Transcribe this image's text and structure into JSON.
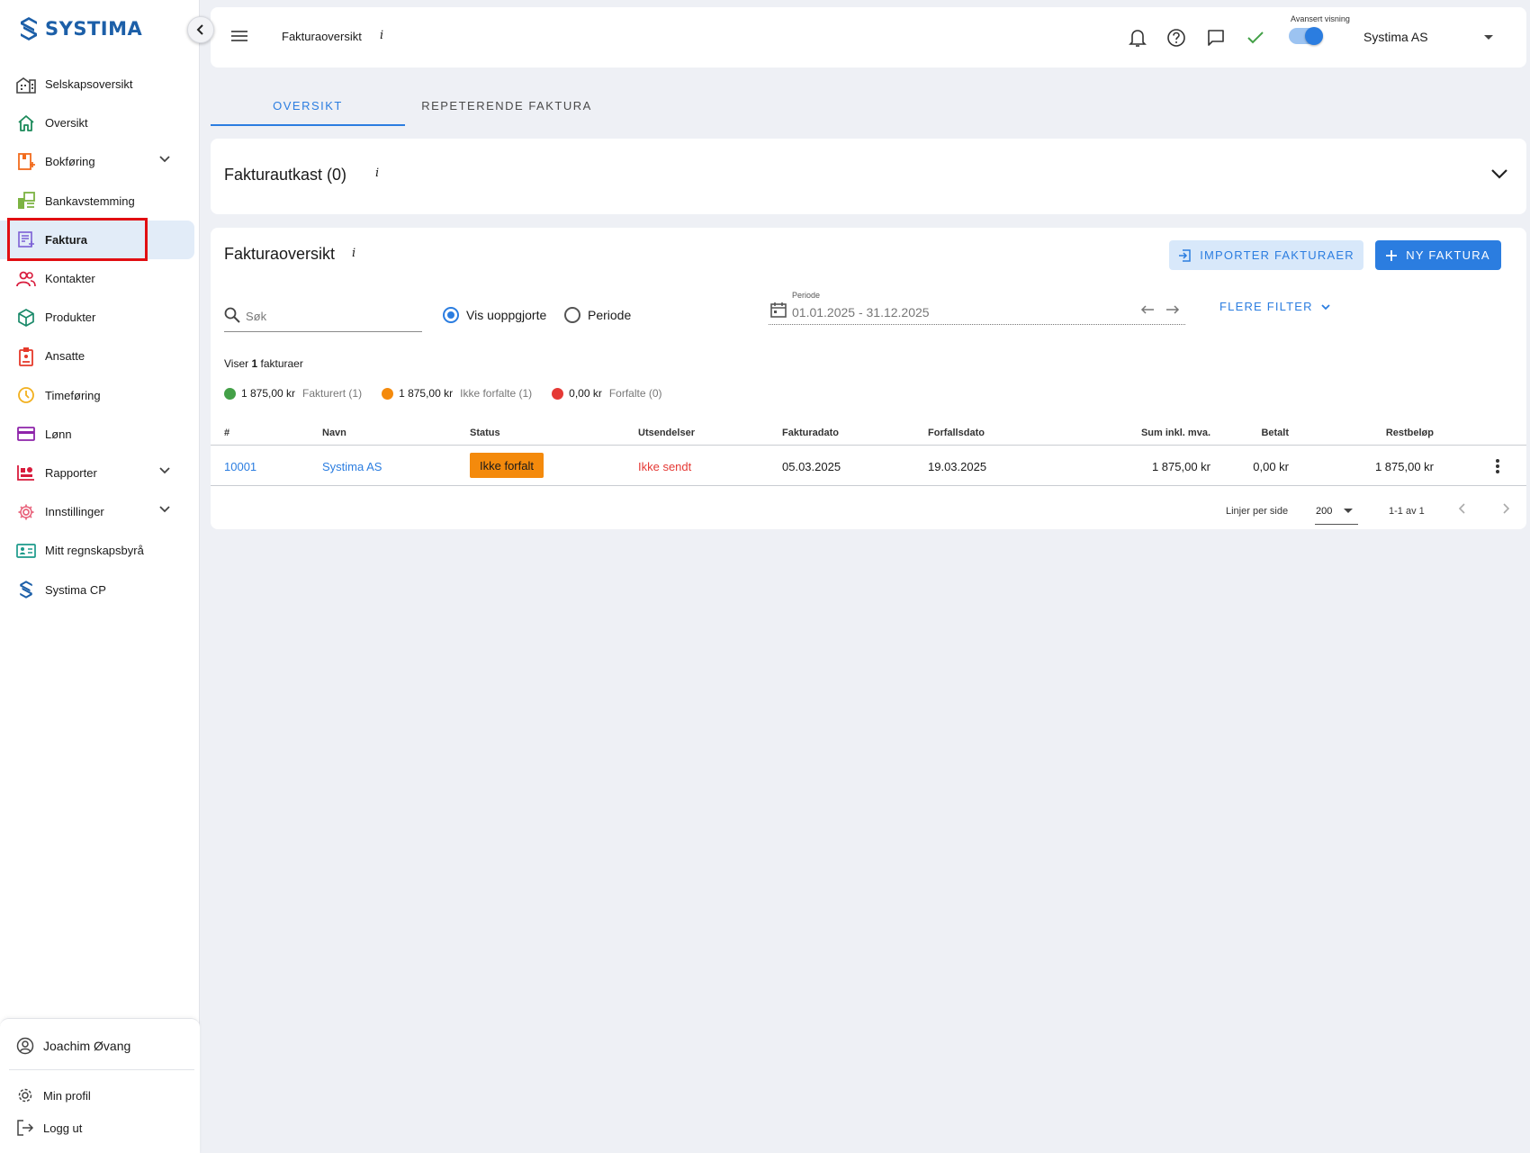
{
  "app": {
    "logo_text": "SYSTIMA",
    "brand_color": "#1c5fa8",
    "accent_color": "#2b7de0"
  },
  "sidebar": {
    "items": [
      {
        "label": "Selskapsoversikt",
        "icon": "buildings-icon"
      },
      {
        "label": "Oversikt",
        "icon": "home-icon"
      },
      {
        "label": "Bokføring",
        "icon": "ledger-icon",
        "expandable": true
      },
      {
        "label": "Bankavstemming",
        "icon": "bank-reconcile-icon"
      },
      {
        "label": "Faktura",
        "icon": "invoice-icon",
        "active": true
      },
      {
        "label": "Kontakter",
        "icon": "contacts-icon"
      },
      {
        "label": "Produkter",
        "icon": "box-icon"
      },
      {
        "label": "Ansatte",
        "icon": "badge-icon"
      },
      {
        "label": "Timeføring",
        "icon": "clock-icon"
      },
      {
        "label": "Lønn",
        "icon": "wallet-icon"
      },
      {
        "label": "Rapporter",
        "icon": "report-icon",
        "expandable": true
      },
      {
        "label": "Innstillinger",
        "icon": "gear-icon",
        "expandable": true
      },
      {
        "label": "Mitt regnskapsbyrå",
        "icon": "id-card-icon"
      },
      {
        "label": "Systima CP",
        "icon": "systima-logo-icon"
      }
    ],
    "user": {
      "name": "Joachim Øvang",
      "profile_label": "Min profil",
      "logout_label": "Logg ut"
    }
  },
  "topbar": {
    "title": "Fakturaoversikt",
    "info": "i",
    "advanced_view_label": "Avansert visning",
    "advanced_view_on": true,
    "company": "Systima AS"
  },
  "tabs": [
    {
      "label": "OVERSIKT",
      "active": true
    },
    {
      "label": "REPETERENDE FAKTURA",
      "active": false
    }
  ],
  "drafts": {
    "title": "Fakturautkast (0)",
    "info": "i"
  },
  "overview": {
    "title": "Fakturaoversikt",
    "info": "i",
    "import_button": "IMPORTER FAKTURAER",
    "new_button": "NY FAKTURA",
    "search_placeholder": "Søk",
    "radio_unsettled": "Vis uoppgjorte",
    "radio_period": "Periode",
    "period_label": "Periode",
    "period_value": "01.01.2025 - 31.12.2025",
    "more_filters": "FLERE FILTER",
    "summary_prefix": "Viser",
    "summary_count": "1",
    "summary_suffix": "fakturaer",
    "legend": [
      {
        "amount": "1 875,00 kr",
        "label": "Fakturert (1)",
        "color": "#43a047"
      },
      {
        "amount": "1 875,00 kr",
        "label": "Ikke forfalte (1)",
        "color": "#f48a0c"
      },
      {
        "amount": "0,00 kr",
        "label": "Forfalte (0)",
        "color": "#e53935"
      }
    ],
    "columns": {
      "num": "#",
      "name": "Navn",
      "status": "Status",
      "sendings": "Utsendelser",
      "invoice_date": "Fakturadato",
      "due_date": "Forfallsdato",
      "sum": "Sum inkl. mva.",
      "paid": "Betalt",
      "remaining": "Restbeløp"
    },
    "rows": [
      {
        "num": "10001",
        "name": "Systima AS",
        "status": "Ikke forfalt",
        "sendings": "Ikke sendt",
        "invoice_date": "05.03.2025",
        "due_date": "19.03.2025",
        "sum": "1 875,00 kr",
        "paid": "0,00 kr",
        "remaining": "1 875,00 kr"
      }
    ],
    "pager": {
      "rows_per_page_label": "Linjer per side",
      "rows_per_page": "200",
      "range": "1-1 av 1"
    }
  }
}
